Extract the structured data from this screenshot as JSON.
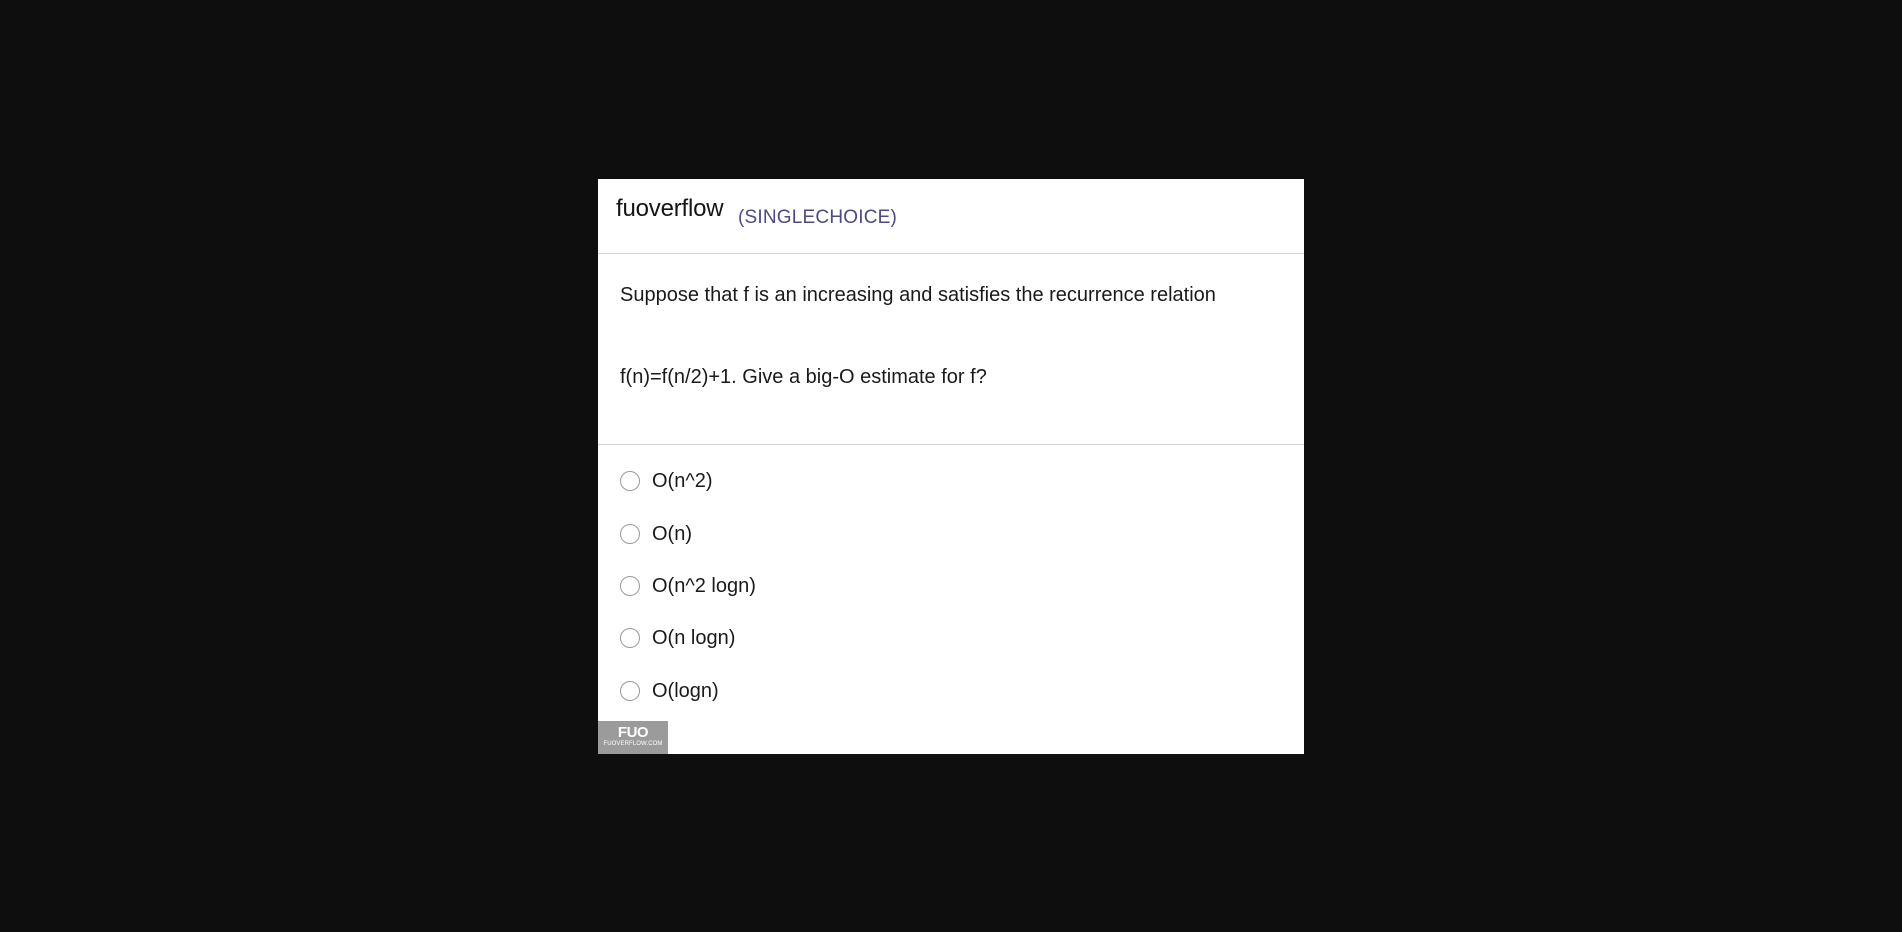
{
  "header": {
    "brand": "fuoverflow",
    "question_type": "(SINGLECHOICE)"
  },
  "question": {
    "line1": "Suppose that f is an increasing and satisfies the recurrence relation",
    "line2": "f(n)=f(n/2)+1. Give a big-O estimate for f?"
  },
  "options": [
    {
      "label": "O(n^2)",
      "selected": false
    },
    {
      "label": "O(n)",
      "selected": false
    },
    {
      "label": "O(n^2 logn)",
      "selected": false
    },
    {
      "label": "O(n logn)",
      "selected": false
    },
    {
      "label": "O(logn)",
      "selected": false
    }
  ],
  "watermark": {
    "logo": "FUO",
    "site": "FUOVERFLOW.COM"
  },
  "colors": {
    "background": "#0e0e0e",
    "card": "#ffffff",
    "question_type": "#4c4a86"
  }
}
